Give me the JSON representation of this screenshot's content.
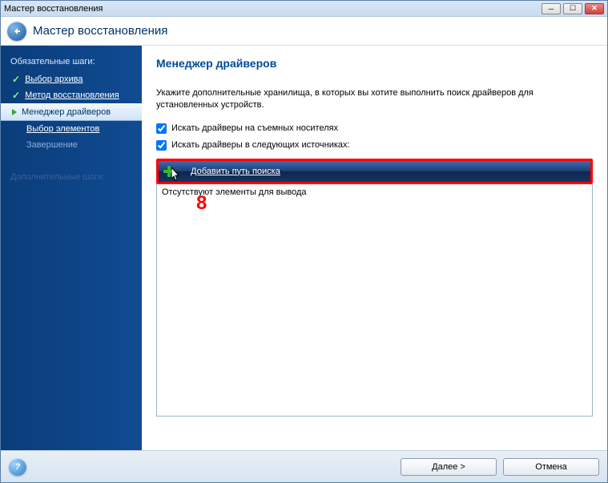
{
  "titlebar": {
    "title": "Мастер восстановления"
  },
  "header": {
    "title": "Мастер восстановления"
  },
  "sidebar": {
    "section_required": "Обязательные шаги:",
    "items": [
      {
        "label": "Выбор архива"
      },
      {
        "label": "Метод восстановления"
      },
      {
        "label": "Менеджер драйверов"
      },
      {
        "label": "Выбор элементов"
      },
      {
        "label": "Завершение"
      }
    ],
    "section_optional": "Дополнительные шаги:"
  },
  "content": {
    "title": "Менеджер драйверов",
    "description": "Укажите дополнительные хранилища, в которых вы хотите выполнить поиск драйверов для установленных устройств.",
    "checkbox_removable": "Искать драйверы на съемных носителях",
    "checkbox_sources": "Искать драйверы в следующих источниках:",
    "add_path_button": "Добавить путь поиска",
    "empty_list": "Отсутствуют элементы для вывода",
    "annotation": "8"
  },
  "footer": {
    "next": "Далее >",
    "cancel": "Отмена"
  }
}
